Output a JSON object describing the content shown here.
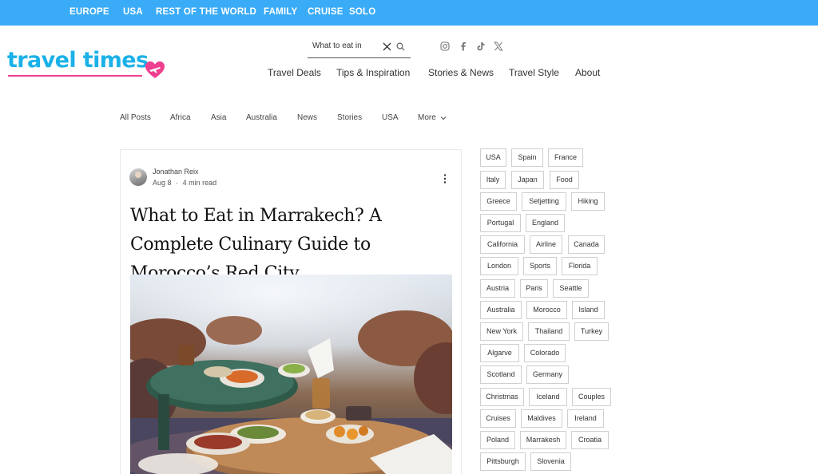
{
  "topbar": {
    "links": [
      "EUROPE",
      "USA",
      "REST OF THE WORLD",
      "FAMILY",
      "CRUISE",
      "SOLO"
    ]
  },
  "logo": {
    "text": "travel times"
  },
  "search": {
    "value": "What to eat in"
  },
  "social": [
    "instagram-icon",
    "facebook-icon",
    "tiktok-icon",
    "x-icon"
  ],
  "main_nav": [
    "Travel Deals",
    "Tips & Inspiration",
    "Stories & News",
    "Travel Style",
    "About"
  ],
  "categories": [
    "All Posts",
    "Africa",
    "Asia",
    "Australia",
    "News",
    "Stories",
    "USA",
    "More"
  ],
  "post": {
    "author": "Jonathan Reix",
    "date": "Aug 8",
    "separator": "·",
    "read_time": "4 min read",
    "title": "What to Eat in Marrakech? A Complete Culinary Guide to Morocco’s Red City"
  },
  "tags": [
    "USA",
    "Spain",
    "France",
    "Italy",
    "Japan",
    "Food",
    "Greece",
    "Setjetting",
    "Hiking",
    "Portugal",
    "England",
    "California",
    "Airline",
    "Canada",
    "London",
    "Sports",
    "Florida",
    "Austria",
    "Paris",
    "Seattle",
    "Australia",
    "Morocco",
    "Island",
    "New York",
    "Thailand",
    "Turkey",
    "Algarve",
    "Colorado",
    "Scotland",
    "Germany",
    "Christmas",
    "Iceland",
    "Couples",
    "Cruises",
    "Maldives",
    "Ireland",
    "Poland",
    "Marrakesh",
    "Croatia",
    "Pittsburgh",
    "Slovenia"
  ],
  "colors": {
    "topbar": "#3aabf7",
    "logo": "#1ab1e8",
    "accent": "#ef3f8f"
  }
}
